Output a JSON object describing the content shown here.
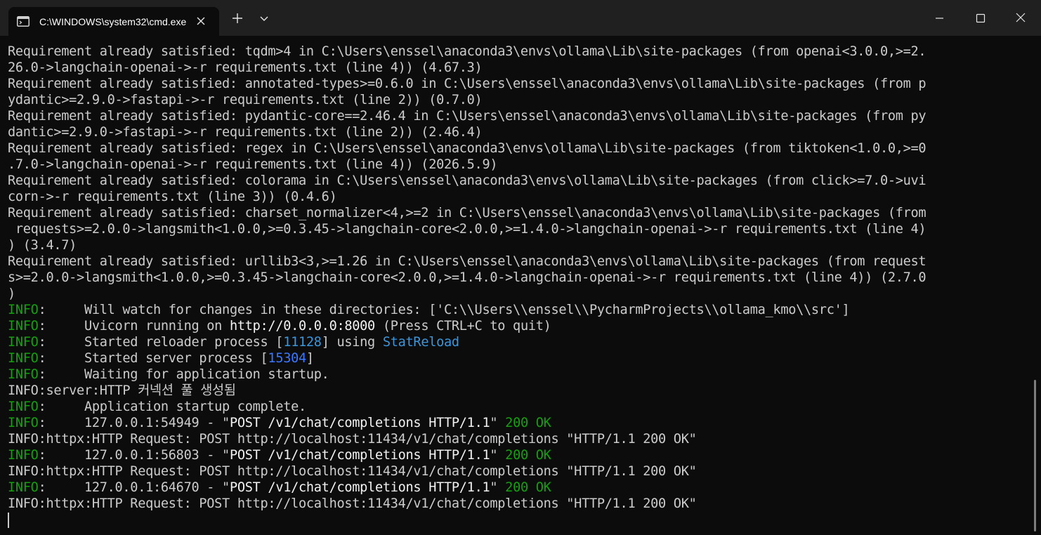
{
  "window": {
    "tab_title": "C:\\WINDOWS\\system32\\cmd.exe",
    "icons": {
      "tab": "terminal-icon",
      "tab_close": "close-icon",
      "new_tab": "plus-icon",
      "dropdown": "chevron-down-icon",
      "minimize": "minimize-icon",
      "maximize": "maximize-icon",
      "close": "close-icon"
    }
  },
  "colors": {
    "background": "#0c0c0c",
    "titlebar": "#202020",
    "default_text": "#cccccc",
    "bright_text": "#f2f2f2",
    "info_green": "#13a10e",
    "pid_blue": "#3b78ff",
    "reload_cyan": "#3a96dd"
  },
  "terminal": {
    "lines": [
      [
        {
          "t": "Requirement already satisfied: tqdm>4 in C:\\Users\\enssel\\anaconda3\\envs\\ollama\\Lib\\site-packages (from openai<3.0.0,>=2."
        }
      ],
      [
        {
          "t": "26.0->langchain-openai->-r requirements.txt (line 4)) (4.67.3)"
        }
      ],
      [
        {
          "t": "Requirement already satisfied: annotated-types>=0.6.0 in C:\\Users\\enssel\\anaconda3\\envs\\ollama\\Lib\\site-packages (from p"
        }
      ],
      [
        {
          "t": "ydantic>=2.9.0->fastapi->-r requirements.txt (line 2)) (0.7.0)"
        }
      ],
      [
        {
          "t": "Requirement already satisfied: pydantic-core==2.46.4 in C:\\Users\\enssel\\anaconda3\\envs\\ollama\\Lib\\site-packages (from py"
        }
      ],
      [
        {
          "t": "dantic>=2.9.0->fastapi->-r requirements.txt (line 2)) (2.46.4)"
        }
      ],
      [
        {
          "t": "Requirement already satisfied: regex in C:\\Users\\enssel\\anaconda3\\envs\\ollama\\Lib\\site-packages (from tiktoken<1.0.0,>=0"
        }
      ],
      [
        {
          "t": ".7.0->langchain-openai->-r requirements.txt (line 4)) (2026.5.9)"
        }
      ],
      [
        {
          "t": "Requirement already satisfied: colorama in C:\\Users\\enssel\\anaconda3\\envs\\ollama\\Lib\\site-packages (from click>=7.0->uvi"
        }
      ],
      [
        {
          "t": "corn->-r requirements.txt (line 3)) (0.4.6)"
        }
      ],
      [
        {
          "t": "Requirement already satisfied: charset_normalizer<4,>=2 in C:\\Users\\enssel\\anaconda3\\envs\\ollama\\Lib\\site-packages (from"
        }
      ],
      [
        {
          "t": " requests>=2.0.0->langsmith<1.0.0,>=0.3.45->langchain-core<2.0.0,>=1.4.0->langchain-openai->-r requirements.txt (line 4)"
        }
      ],
      [
        {
          "t": ") (3.4.7)"
        }
      ],
      [
        {
          "t": "Requirement already satisfied: urllib3<3,>=1.26 in C:\\Users\\enssel\\anaconda3\\envs\\ollama\\Lib\\site-packages (from request"
        }
      ],
      [
        {
          "t": "s>=2.0.0->langsmith<1.0.0,>=0.3.45->langchain-core<2.0.0,>=1.4.0->langchain-openai->-r requirements.txt (line 4)) (2.7.0"
        }
      ],
      [
        {
          "t": ")"
        }
      ],
      [
        {
          "t": "INFO",
          "c": "info"
        },
        {
          "t": ":     Will watch for changes in these directories: ['C:\\\\Users\\\\enssel\\\\PycharmProjects\\\\ollama_kmo\\\\src']"
        }
      ],
      [
        {
          "t": "INFO",
          "c": "info"
        },
        {
          "t": ":     Uvicorn running on "
        },
        {
          "t": "http://0.0.0.0:8000",
          "c": "bright"
        },
        {
          "t": " (Press CTRL+C to quit)"
        }
      ],
      [
        {
          "t": "INFO",
          "c": "info"
        },
        {
          "t": ":     Started reloader process ["
        },
        {
          "t": "11128",
          "c": "cyan"
        },
        {
          "t": "] using "
        },
        {
          "t": "StatReload",
          "c": "cyan"
        }
      ],
      [
        {
          "t": "INFO",
          "c": "info"
        },
        {
          "t": ":     Started server process ["
        },
        {
          "t": "15304",
          "c": "blue"
        },
        {
          "t": "]"
        }
      ],
      [
        {
          "t": "INFO",
          "c": "info"
        },
        {
          "t": ":     Waiting for application startup."
        }
      ],
      [
        {
          "t": "INFO:server:HTTP 커넥션 풀 생성됨"
        }
      ],
      [
        {
          "t": "INFO",
          "c": "info"
        },
        {
          "t": ":     Application startup complete."
        }
      ],
      [
        {
          "t": "INFO",
          "c": "info"
        },
        {
          "t": ":     127.0.0.1:54949 - \""
        },
        {
          "t": "POST /v1/chat/completions HTTP/1.1",
          "c": "bright"
        },
        {
          "t": "\" "
        },
        {
          "t": "200 OK",
          "c": "info"
        }
      ],
      [
        {
          "t": "INFO:httpx:HTTP Request: POST http://localhost:11434/v1/chat/completions \"HTTP/1.1 200 OK\""
        }
      ],
      [
        {
          "t": "INFO",
          "c": "info"
        },
        {
          "t": ":     127.0.0.1:56803 - \""
        },
        {
          "t": "POST /v1/chat/completions HTTP/1.1",
          "c": "bright"
        },
        {
          "t": "\" "
        },
        {
          "t": "200 OK",
          "c": "info"
        }
      ],
      [
        {
          "t": "INFO:httpx:HTTP Request: POST http://localhost:11434/v1/chat/completions \"HTTP/1.1 200 OK\""
        }
      ],
      [
        {
          "t": "INFO",
          "c": "info"
        },
        {
          "t": ":     127.0.0.1:64670 - \""
        },
        {
          "t": "POST /v1/chat/completions HTTP/1.1",
          "c": "bright"
        },
        {
          "t": "\" "
        },
        {
          "t": "200 OK",
          "c": "info"
        }
      ],
      [
        {
          "t": "INFO:httpx:HTTP Request: POST http://localhost:11434/v1/chat/completions \"HTTP/1.1 200 OK\""
        }
      ]
    ]
  }
}
